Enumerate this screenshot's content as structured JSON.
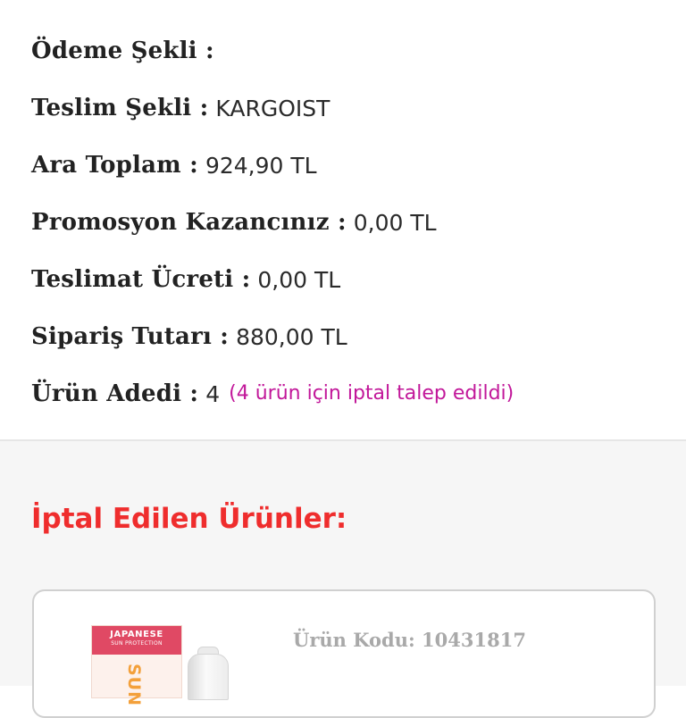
{
  "order_summary": {
    "payment_method": {
      "label": "Ödeme Şekli :",
      "value": ""
    },
    "delivery_method": {
      "label": "Teslim Şekli :",
      "value": "KARGOIST"
    },
    "subtotal": {
      "label": "Ara Toplam :",
      "value": "924,90 TL"
    },
    "promotion_savings": {
      "label": "Promosyon Kazancınız :",
      "value": "0,00 TL"
    },
    "delivery_fee": {
      "label": "Teslimat Ücreti :",
      "value": "0,00 TL"
    },
    "order_total": {
      "label": "Sipariş Tutarı :",
      "value": "880,00 TL"
    },
    "item_count": {
      "label": "Ürün Adedi :",
      "value": "4",
      "note": "(4 ürün için iptal talep edildi)"
    }
  },
  "cancelled_section": {
    "title": "İptal Edilen Ürünler:",
    "items": [
      {
        "product_code": "Ürün Kodu: 10431817",
        "image": {
          "brand_line_1": "JAPANESE",
          "brand_line_2": "SUN PROTECTION",
          "vertical_word": "SUN"
        }
      }
    ]
  },
  "colors": {
    "accent_red": "#ef2d2d",
    "note_magenta": "#c2189a",
    "label_text": "#222222",
    "muted_text": "#a9a9a9",
    "card_border": "#d0d0d0",
    "section_background": "#f6f6f6"
  }
}
